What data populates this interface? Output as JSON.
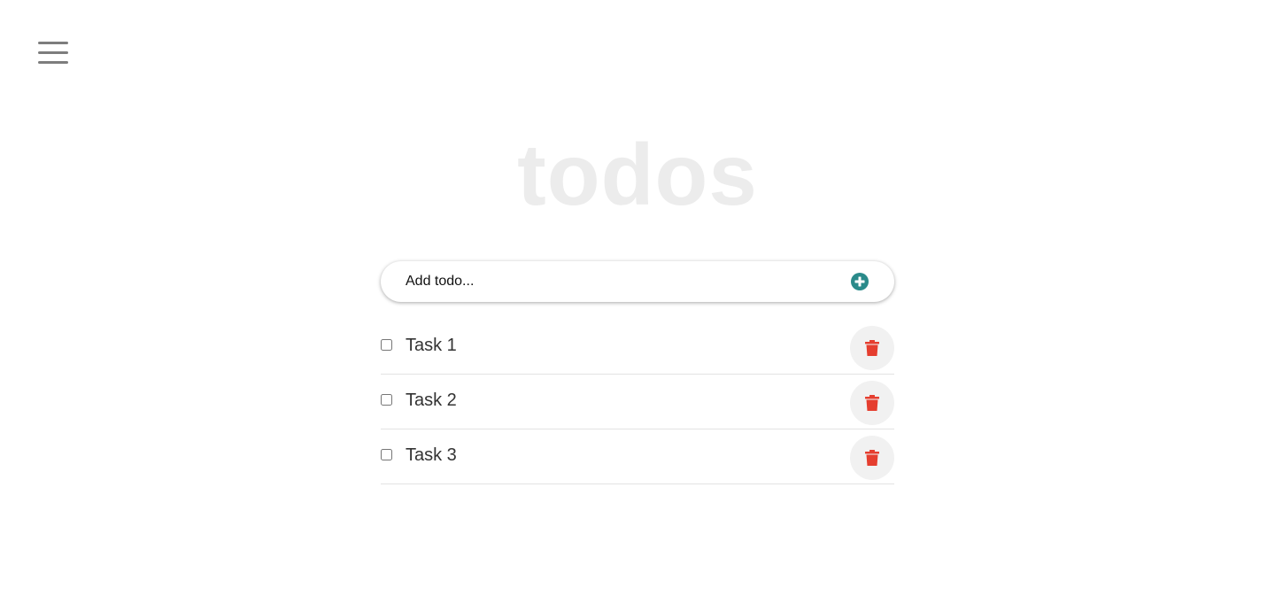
{
  "header": {
    "menu_icon": "hamburger-menu-icon",
    "title": "todos"
  },
  "add_todo": {
    "placeholder": "Add todo...",
    "add_icon": "plus-circle-icon",
    "accent_color": "#2a8a8a"
  },
  "todos": [
    {
      "label": "Task 1",
      "completed": false,
      "delete_icon": "trash-icon"
    },
    {
      "label": "Task 2",
      "completed": false,
      "delete_icon": "trash-icon"
    },
    {
      "label": "Task 3",
      "completed": false,
      "delete_icon": "trash-icon"
    }
  ],
  "colors": {
    "title": "#ececec",
    "delete": "#e53e2f",
    "delete_bg": "#f1f1f1",
    "text": "#333333"
  }
}
